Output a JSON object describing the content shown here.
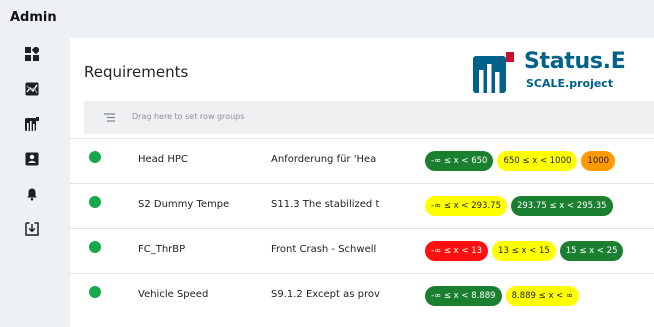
{
  "app": {
    "title": "Admin"
  },
  "sidebar": {
    "items": [
      {
        "name": "dashboard-icon"
      },
      {
        "name": "chart-icon"
      },
      {
        "name": "status-logo-icon"
      },
      {
        "name": "contact-card-icon"
      },
      {
        "name": "bell-icon"
      },
      {
        "name": "download-icon"
      }
    ]
  },
  "page": {
    "title": "Requirements"
  },
  "logo": {
    "name": "Status.E",
    "subtitle": "SCALE.project"
  },
  "grouping": {
    "placeholder": "Drag here to set row groups"
  },
  "colors": {
    "green": "#1a7f2f",
    "yellow": "#ffff00",
    "orange": "#ff9a00",
    "red": "#ff1010",
    "status_ok": "#17a84b",
    "brand": "#00628b"
  },
  "rows": [
    {
      "name": "Head HPC",
      "description": "Anforderung für 'Hea",
      "chips": [
        {
          "label": "-∞ ≤ x < 650",
          "color": "green"
        },
        {
          "label": "650 ≤ x < 1000",
          "color": "yellow"
        },
        {
          "label": "1000",
          "color": "orange"
        }
      ]
    },
    {
      "name": "S2 Dummy Tempe",
      "description": "S11.3 The stabilized t",
      "chips": [
        {
          "label": "-∞ ≤ x < 293.75",
          "color": "yellow"
        },
        {
          "label": "293.75 ≤ x < 295.35",
          "color": "green"
        }
      ]
    },
    {
      "name": "FC_ThrBP",
      "description": "Front Crash - Schwell",
      "chips": [
        {
          "label": "-∞ ≤ x < 13",
          "color": "red"
        },
        {
          "label": "13 ≤ x < 15",
          "color": "yellow"
        },
        {
          "label": "15 ≤ x < 25",
          "color": "green"
        }
      ]
    },
    {
      "name": "Vehicle Speed",
      "description": "S9.1.2 Except as prov",
      "chips": [
        {
          "label": "-∞ ≤ x < 8.889",
          "color": "green"
        },
        {
          "label": "8.889 ≤ x < ∞",
          "color": "yellow"
        }
      ]
    }
  ]
}
